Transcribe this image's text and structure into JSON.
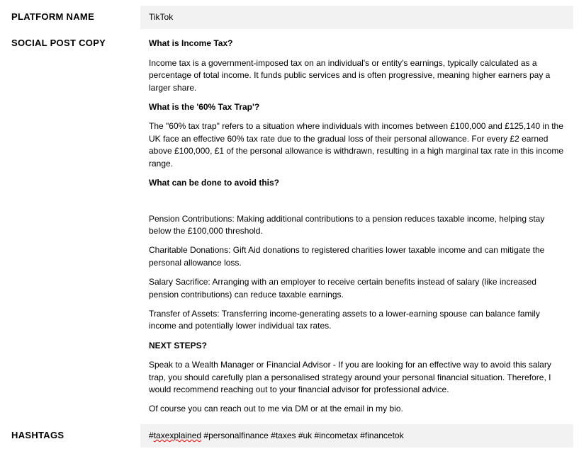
{
  "rows": {
    "platform": {
      "label": "PLATFORM NAME",
      "value": "TikTok"
    },
    "copy": {
      "label": "SOCIAL POST COPY",
      "paragraphs": [
        {
          "type": "heading",
          "text": "What is Income Tax?"
        },
        {
          "type": "para",
          "text": "Income tax is a government-imposed tax on an individual's or entity's earnings, typically calculated as a percentage of total income. It funds public services and is often progressive, meaning higher earners pay a larger share."
        },
        {
          "type": "heading",
          "text": "What is the '60% Tax Trap'?"
        },
        {
          "type": "para",
          "text": "The \"60% tax trap\" refers to a situation where individuals with incomes between £100,000 and £125,140 in the UK face an effective 60% tax rate due to the gradual loss of their personal allowance. For every £2 earned above £100,000, £1 of the personal allowance is withdrawn, resulting in a high marginal tax rate in this income range."
        },
        {
          "type": "heading",
          "text": "What can be done to avoid this?"
        },
        {
          "type": "spacer",
          "text": ""
        },
        {
          "type": "para",
          "text": "Pension Contributions: Making additional contributions to a pension reduces taxable income, helping stay below the £100,000 threshold."
        },
        {
          "type": "para",
          "text": "Charitable Donations: Gift Aid donations to registered charities lower taxable income and can mitigate the personal allowance loss."
        },
        {
          "type": "para",
          "text": "Salary Sacrifice: Arranging with an employer to receive certain benefits instead of salary (like increased pension contributions) can reduce taxable earnings."
        },
        {
          "type": "para",
          "text": "Transfer of Assets: Transferring income-generating assets to a lower-earning spouse can balance family income and potentially lower individual tax rates."
        },
        {
          "type": "heading",
          "text": "NEXT STEPS?"
        },
        {
          "type": "para",
          "text": "Speak to a Wealth Manager or Financial Advisor - If you are looking for an effective way to avoid this salary trap, you should carefully plan a personalised strategy around your personal financial situation. Therefore, I would recommend reaching out to your financial advisor for professional advice."
        },
        {
          "type": "para",
          "text": "Of course you can reach out to me via DM or at the email in my bio."
        }
      ]
    },
    "hashtags": {
      "label": "HASHTAGS",
      "prefix_marked": "taxexplained",
      "rest": " #personalfinance #taxes #uk #incometax #financetok"
    }
  }
}
